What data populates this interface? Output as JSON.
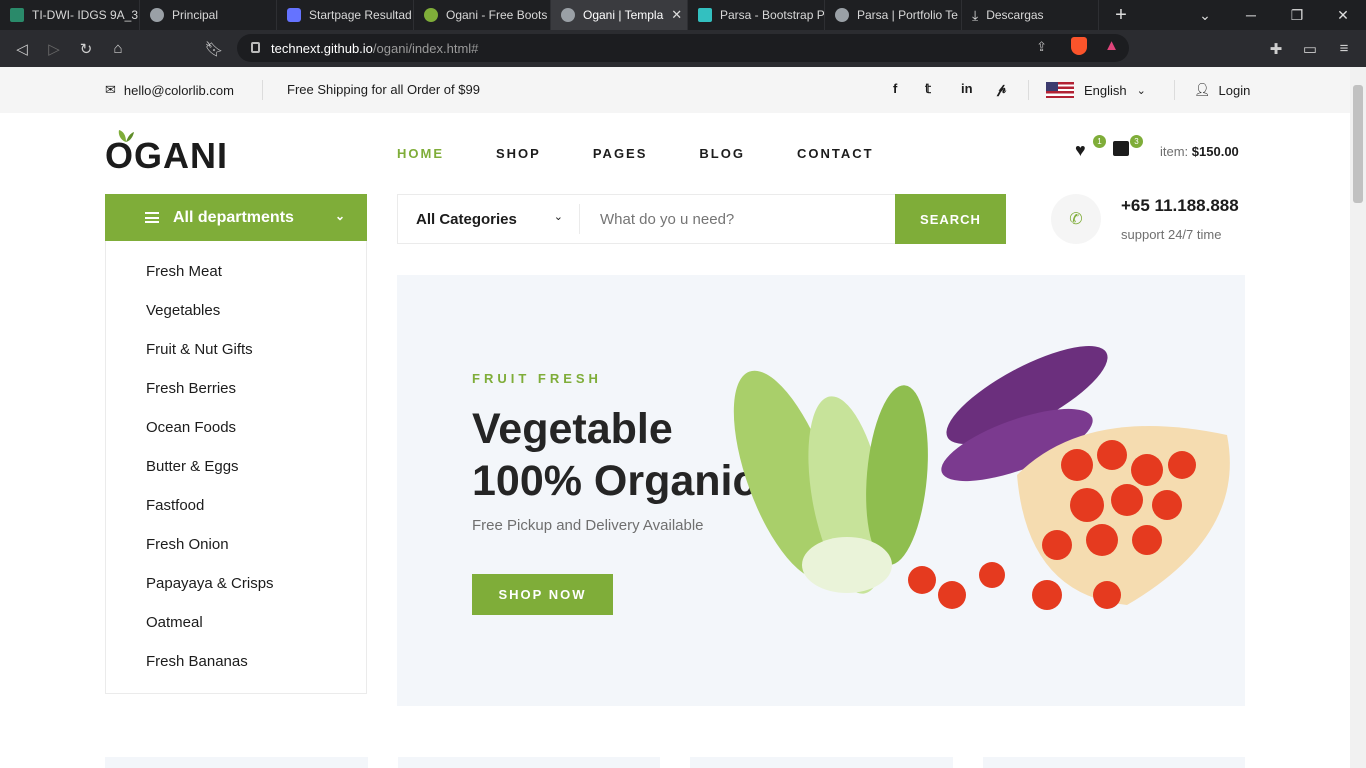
{
  "browser": {
    "tabs": [
      {
        "title": "TI-DWI- IDGS 9A_3",
        "active": false,
        "color": "#2a8a6a"
      },
      {
        "title": "Principal",
        "active": false,
        "color": "#9aa0a6"
      },
      {
        "title": "Startpage Resultad",
        "active": false,
        "color": "#6573ff"
      },
      {
        "title": "Ogani - Free Boots",
        "active": false,
        "color": "#7fad39"
      },
      {
        "title": "Ogani | Templa",
        "active": true,
        "color": "#9aa0a6"
      },
      {
        "title": "Parsa - Bootstrap P",
        "active": false,
        "color": "#33c0c0"
      },
      {
        "title": "Parsa | Portfolio Te",
        "active": false,
        "color": "#9aa0a6"
      },
      {
        "title": "Descargas",
        "active": false,
        "color": "#9aa0a6"
      }
    ],
    "url_host": "technext.github.io",
    "url_path": "/ogani/index.html#"
  },
  "topbar": {
    "email": "hello@colorlib.com",
    "shipping": "Free Shipping for all Order of $99",
    "language": "English",
    "login": "Login"
  },
  "header": {
    "logo": "OGANI",
    "nav": [
      "HOME",
      "SHOP",
      "PAGES",
      "BLOG",
      "CONTACT"
    ],
    "active_nav": "HOME",
    "wishlist_count": "1",
    "cart_count": "3",
    "item_label": "item:",
    "item_total": "$150.00"
  },
  "departments": {
    "title": "All departments",
    "items": [
      "Fresh Meat",
      "Vegetables",
      "Fruit & Nut Gifts",
      "Fresh Berries",
      "Ocean Foods",
      "Butter & Eggs",
      "Fastfood",
      "Fresh Onion",
      "Papayaya & Crisps",
      "Oatmeal",
      "Fresh Bananas"
    ]
  },
  "search": {
    "category": "All Categories",
    "placeholder": "What do yo u need?",
    "button": "SEARCH"
  },
  "contact": {
    "phone": "+65 11.188.888",
    "support": "support 24/7 time"
  },
  "hero": {
    "kicker": "FRUIT FRESH",
    "title_line1": "Vegetable",
    "title_line2": "100% Organic",
    "subtitle": "Free Pickup and Delivery Available",
    "cta": "SHOP NOW"
  },
  "colors": {
    "accent": "#7fad39",
    "text": "#1c1c1c"
  }
}
